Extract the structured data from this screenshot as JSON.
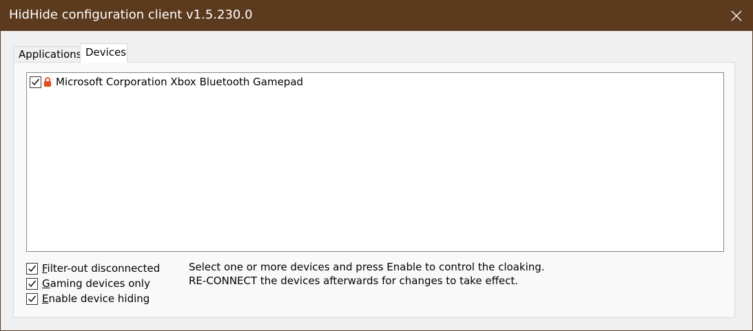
{
  "window": {
    "title": "HidHide configuration client v1.5.230.0",
    "close_icon": "close-icon",
    "titlebar_color": "#5b3a1e"
  },
  "tabs": [
    {
      "label": "Applications",
      "selected": false
    },
    {
      "label": "Devices",
      "selected": true
    }
  ],
  "devices": [
    {
      "label": "Microsoft Corporation Xbox Bluetooth Gamepad",
      "checked": true,
      "icon": "lock-icon",
      "icon_color": "#e8491d"
    }
  ],
  "options": {
    "filter_out_disconnected": {
      "prefix": "F",
      "rest": "ilter-out disconnected",
      "checked": true
    },
    "gaming_devices_only": {
      "prefix": "G",
      "rest": "aming devices only",
      "checked": true
    },
    "enable_device_hiding": {
      "prefix": "E",
      "rest": "nable device hiding",
      "checked": true
    }
  },
  "instructions": {
    "line1": "Select one or more devices and press Enable to control the cloaking.",
    "line2": "RE-CONNECT the devices afterwards for changes to take effect."
  }
}
